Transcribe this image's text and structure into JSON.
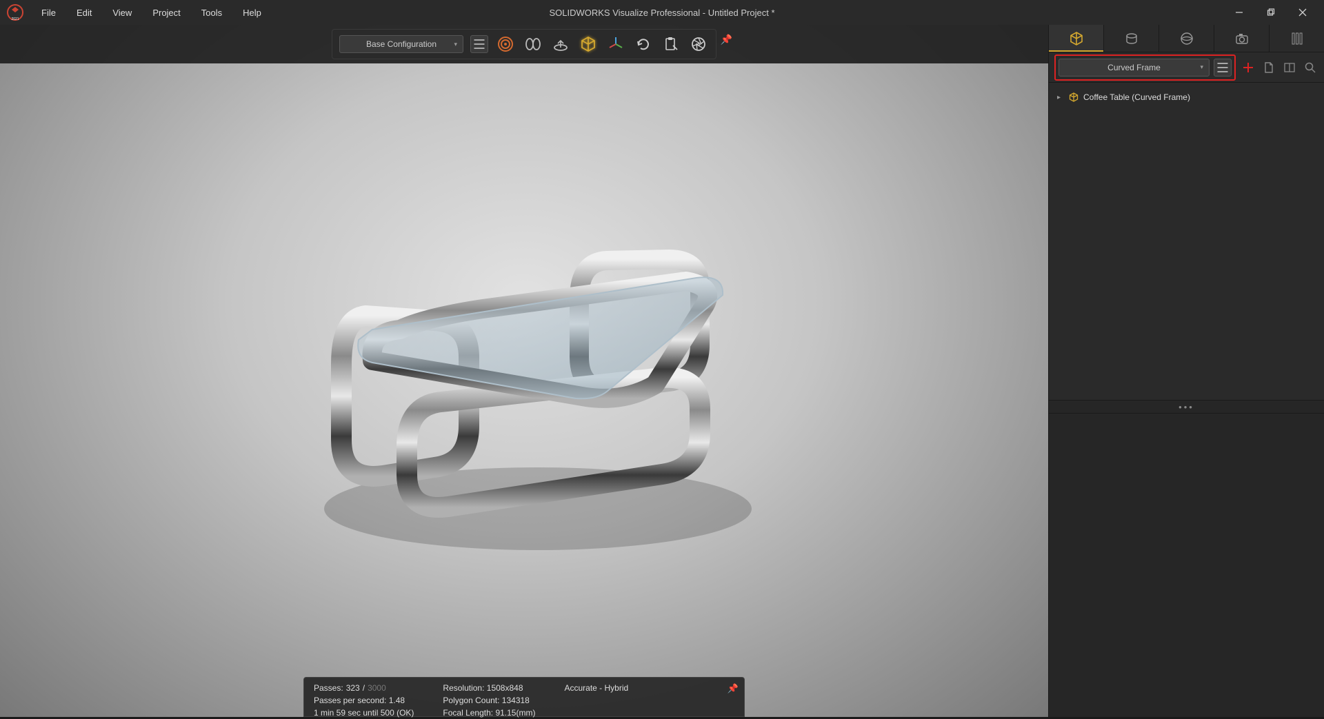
{
  "window": {
    "title": "SOLIDWORKS Visualize Professional - Untitled Project *",
    "app_year": "2021"
  },
  "menubar": [
    "File",
    "Edit",
    "View",
    "Project",
    "Tools",
    "Help"
  ],
  "toolbar": {
    "config_label": "Base Configuration"
  },
  "status": {
    "passes_label": "Passes:",
    "passes_current": "323",
    "passes_slash": "/",
    "passes_total": "3000",
    "pps": "Passes per second: 1.48",
    "eta": "1 min 59 sec until 500 (OK)",
    "resolution": "Resolution: 1508x848",
    "polycount": "Polygon Count: 134318",
    "focal": "Focal Length: 91.15(mm)",
    "mode": "Accurate - Hybrid"
  },
  "sidepanel": {
    "sub_dropdown": "Curved Frame",
    "tree_item": "Coffee Table (Curved Frame)"
  }
}
